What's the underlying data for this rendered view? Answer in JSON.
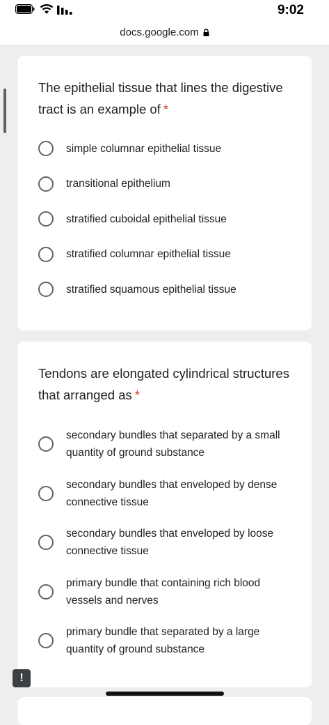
{
  "status_bar": {
    "time": "9:02",
    "icons": [
      "battery-icon",
      "wifi-icon",
      "signal-icon"
    ]
  },
  "browser": {
    "url": "docs.google.com",
    "url_icon": "lock-icon"
  },
  "questions": [
    {
      "title": "The epithelial tissue that lines the digestive tract is an example of",
      "required": "*",
      "options": [
        "simple columnar epithelial tissue",
        "transitional epithelium",
        "stratified cuboidal epithelial tissue",
        "stratified columnar epithelial tissue",
        "stratified squamous epithelial tissue"
      ]
    },
    {
      "title": "Tendons are elongated cylindrical structures that arranged as",
      "required": "*",
      "options": [
        "secondary bundles that separated by a small quantity of ground substance",
        "secondary bundles that enveloped by dense connective tissue",
        "secondary bundles that enveloped by loose connective tissue",
        "primary bundle that containing rich blood vessels and nerves",
        "primary bundle that separated by a large quantity of ground substance"
      ]
    }
  ],
  "feedback": {
    "label": "!",
    "icon": "feedback-icon"
  },
  "colors": {
    "background": "#eeeeee",
    "card": "#ffffff",
    "required": "#d93025",
    "radio_border": "#5f6368"
  }
}
